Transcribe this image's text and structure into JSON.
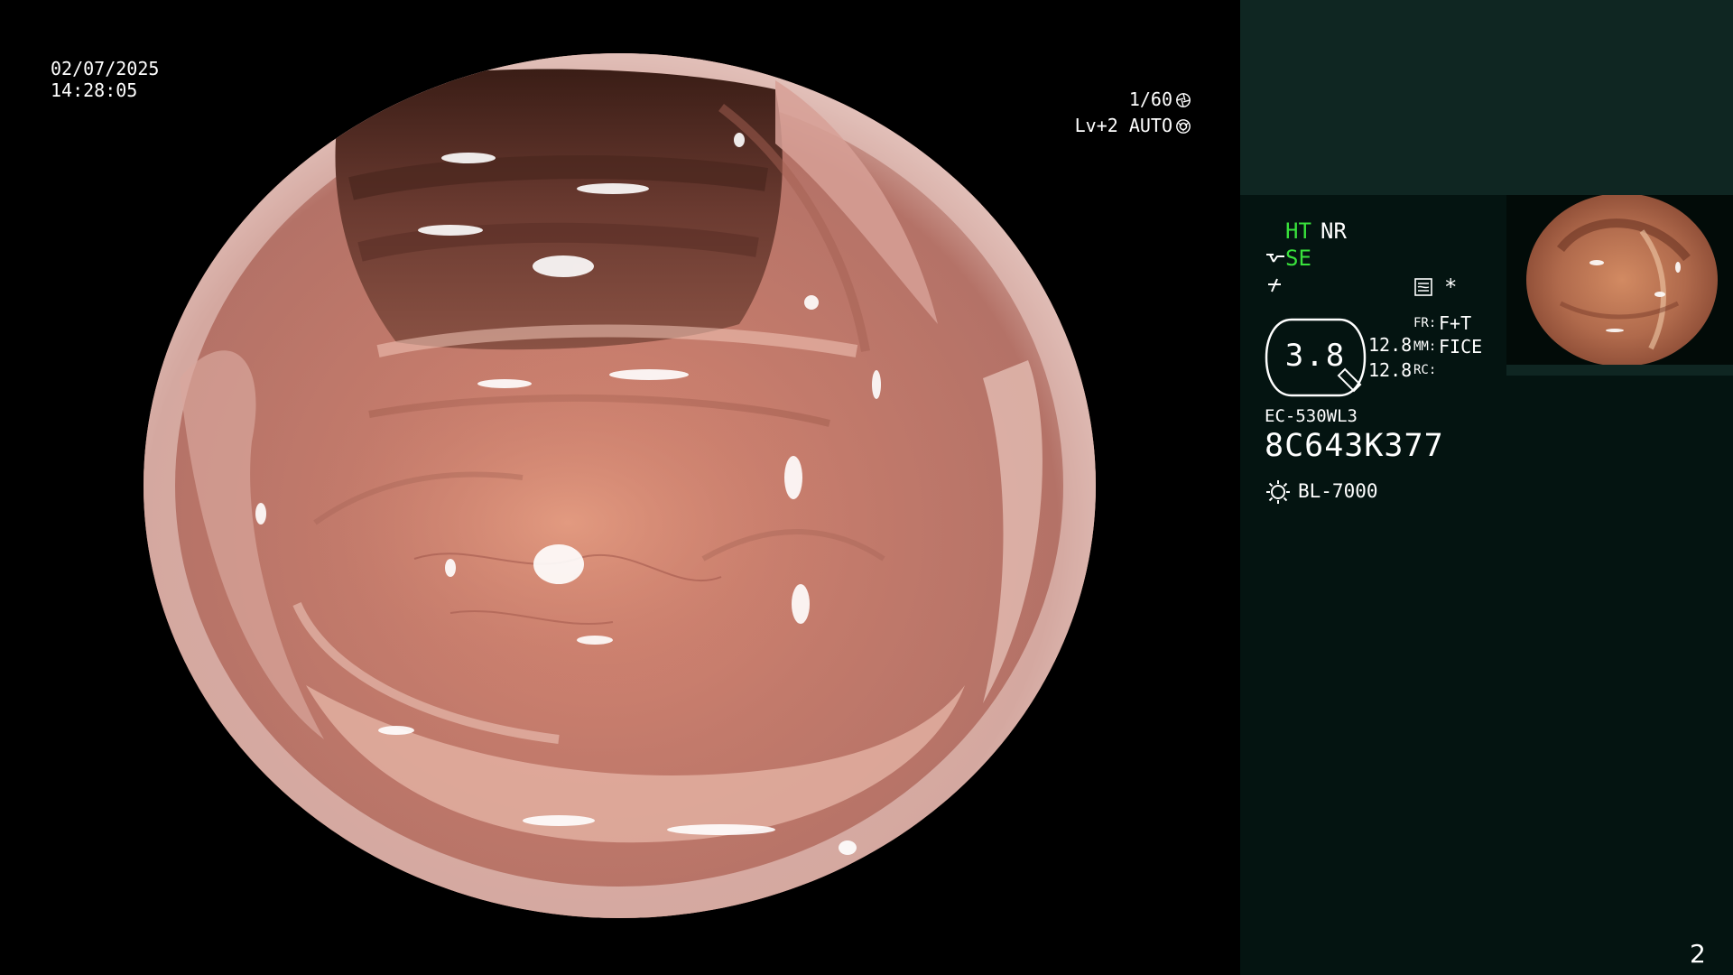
{
  "overlay": {
    "date": "02/07/2025",
    "time": "14:28:05",
    "shutter": "1/60",
    "shutter_icon": "aperture-icon",
    "iris": "Lv+2 AUTO",
    "iris_icon": "iris-icon"
  },
  "panel": {
    "ht": "HT",
    "nr": "NR",
    "se": "SE",
    "se_icon": "structure-enhance-icon",
    "cut_icon": "cut-icon",
    "hdr_icon": "image-mode-icon",
    "star": "*",
    "zoom_value": "3.8",
    "value_1": "12.8",
    "value_2": "12.8",
    "fr_label": "FR:",
    "fr_value": "F+T",
    "mm_label": "MM:",
    "mm_value": "FICE",
    "rc_label": "RC:",
    "scope_model": "EC-530WL3",
    "scope_serial": "8C643K377",
    "light_icon": "light-source-icon",
    "light_source": "BL-7000",
    "page_number": "2"
  },
  "colors": {
    "panel_bg": "#041411",
    "panel_top_bg": "#0f2622",
    "accent_green": "#39e23c",
    "text": "#ffffff"
  }
}
